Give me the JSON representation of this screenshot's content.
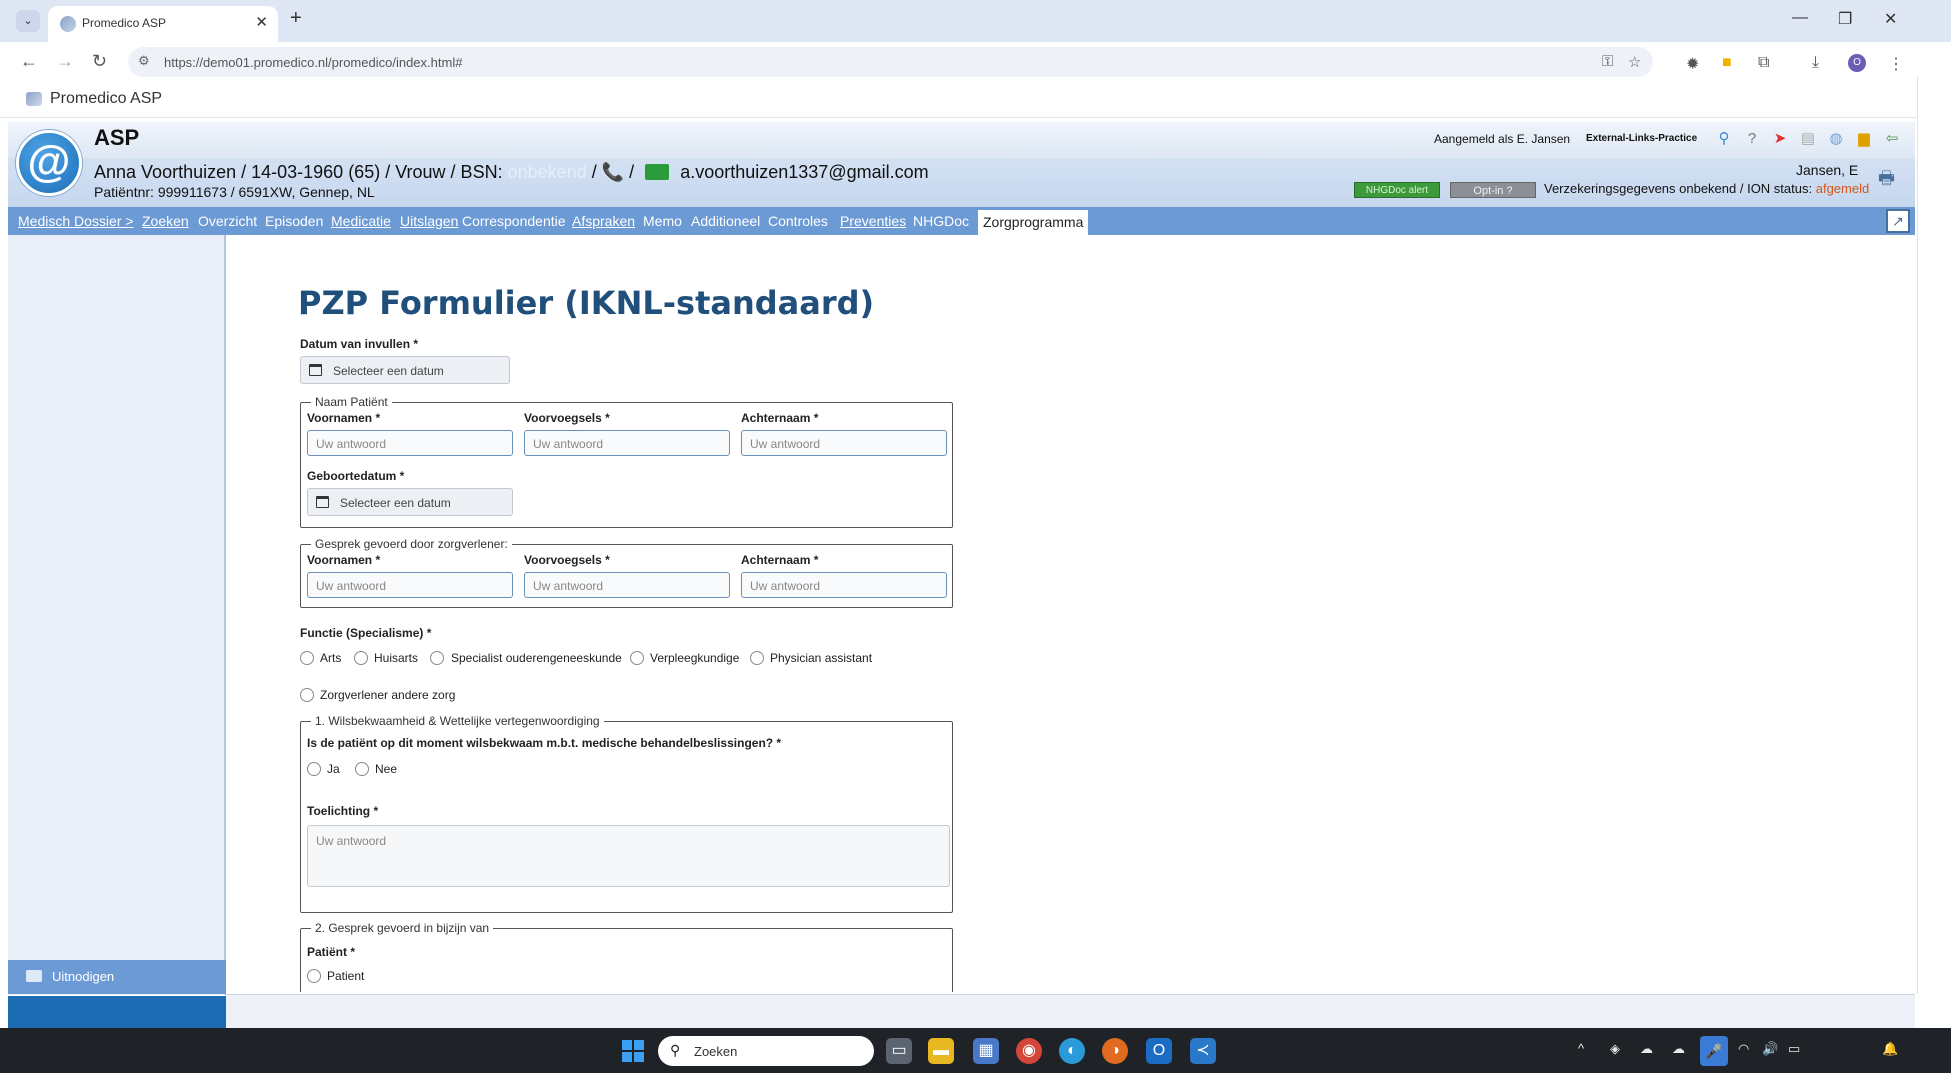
{
  "browser": {
    "tab_title": "Promedico ASP",
    "url": "https://demo01.promedico.nl/promedico/index.html#",
    "profile_initial": "O"
  },
  "app": {
    "window_title": "Promedico ASP",
    "product": "ASP",
    "logo_glyph": "@"
  },
  "patient": {
    "summary": "Anna Voorthuizen / 14-03-1960 (65) / Vrouw / BSN:",
    "bsn": "onbekend",
    "separator": "/",
    "email": "a.voorthuizen1337@gmail.com",
    "patient_nr_line": "Patiëntnr: 999911673 / 6591XW, Gennep, NL"
  },
  "header": {
    "logged_in": "Aangemeld als E. Jansen",
    "external_links": "External-Links-Practice",
    "provider": "Jansen, E",
    "nhgdoc_alert": "NHGDoc alert",
    "opt_in": "Opt-in ?",
    "insurance_text": "Verzekeringsgegevens onbekend / ION status:",
    "insurance_status": "afgemeld"
  },
  "nav": {
    "items": [
      "Medisch Dossier >",
      "Zoeken",
      "Overzicht",
      "Episoden",
      "Medicatie",
      "Uitslagen",
      "Correspondentie",
      "Afspraken",
      "Memo",
      "Additioneel",
      "Controles",
      "Preventies",
      "NHGDoc"
    ],
    "active": "Zorgprogramma"
  },
  "sidebar": {
    "invite_label": "Uitnodigen"
  },
  "form": {
    "title": "PZP Formulier (IKNL-standaard)",
    "date_label": "Datum van invullen *",
    "date_placeholder": "Selecteer een datum",
    "patient_group": {
      "legend": "Naam Patiënt",
      "first_names_label": "Voornamen *",
      "prefix_label": "Voorvoegsels *",
      "last_name_label": "Achternaam *",
      "placeholder": "Uw antwoord",
      "birthdate_label": "Geboortedatum *",
      "birthdate_placeholder": "Selecteer een datum"
    },
    "caregiver_group": {
      "legend": "Gesprek gevoerd door zorgverlener:",
      "first_names_label": "Voornamen *",
      "prefix_label": "Voorvoegsels *",
      "last_name_label": "Achternaam *",
      "placeholder": "Uw antwoord"
    },
    "function": {
      "label": "Functie (Specialisme) *",
      "options": [
        "Arts",
        "Huisarts",
        "Specialist ouderengeneeskunde",
        "Verpleegkundige",
        "Physician assistant",
        "Zorgverlener andere zorg"
      ]
    },
    "section1": {
      "legend": "1. Wilsbekwaamheid & Wettelijke vertegenwoordiging",
      "question": "Is de patiënt op dit moment wilsbekwaam m.b.t. medische behandelbeslissingen? *",
      "yes": "Ja",
      "no": "Nee",
      "explanation_label": "Toelichting *",
      "explanation_placeholder": "Uw antwoord"
    },
    "section2": {
      "legend": "2. Gesprek gevoerd in bijzijn van",
      "patient_label": "Patiënt *",
      "patient_option": "Patient"
    }
  },
  "taskbar": {
    "search_placeholder": "Zoeken"
  },
  "colors": {
    "nav_bg": "#6c9ad4",
    "title": "#1f4f7a",
    "status_orange": "#d9561c",
    "alert_green": "#3d9a3b"
  }
}
